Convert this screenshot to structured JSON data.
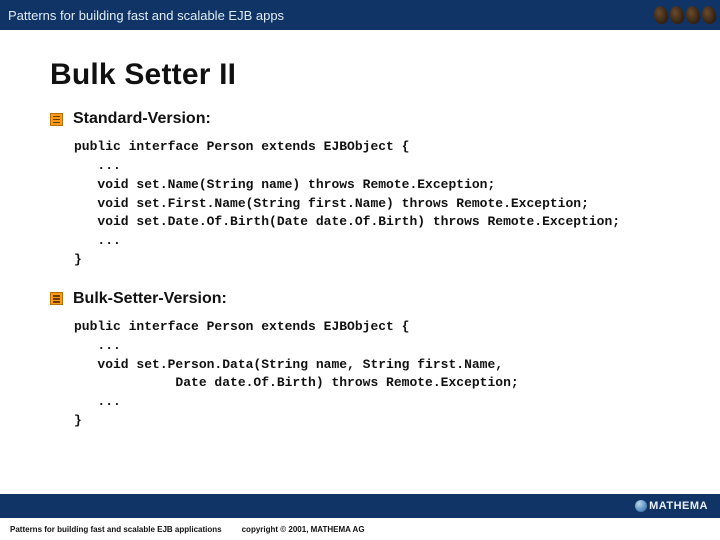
{
  "header": {
    "title": "Patterns for building fast and scalable EJB apps"
  },
  "slide": {
    "title": "Bulk Setter II",
    "sections": [
      {
        "heading": "Standard-Version:",
        "code": "public interface Person extends EJBObject {\n   ...\n   void set.Name(String name) throws Remote.Exception;\n   void set.First.Name(String first.Name) throws Remote.Exception;\n   void set.Date.Of.Birth(Date date.Of.Birth) throws Remote.Exception;\n   ...\n}"
      },
      {
        "heading": "Bulk-Setter-Version:",
        "code": "public interface Person extends EJBObject {\n   ...\n   void set.Person.Data(String name, String first.Name,\n             Date date.Of.Birth) throws Remote.Exception;\n   ...\n}"
      }
    ]
  },
  "footer": {
    "left": "Patterns for building fast and scalable EJB applications",
    "copyright": "copyright © 2001, MATHEMA AG",
    "logo_text": "MATHEMA"
  }
}
